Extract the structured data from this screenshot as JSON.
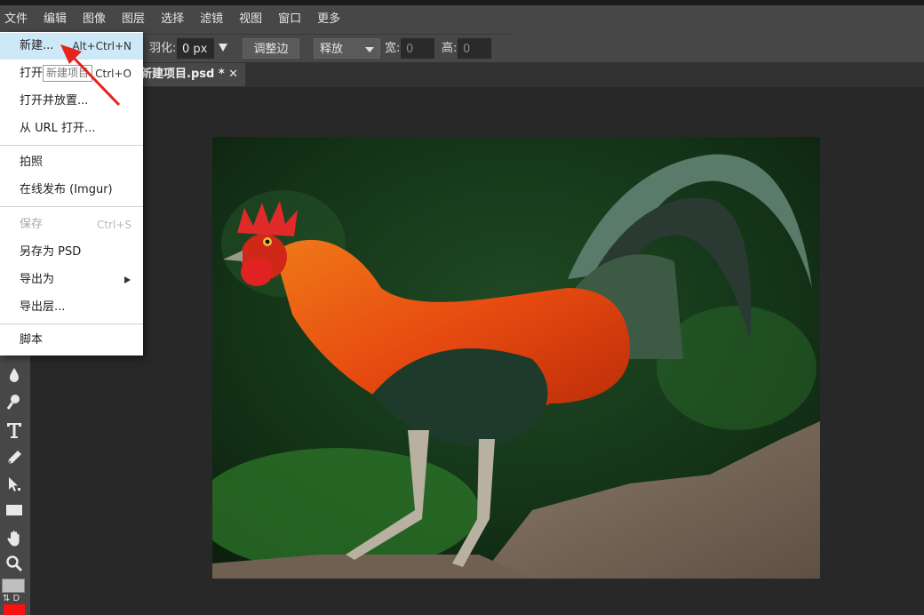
{
  "menubar": {
    "items": [
      "文件",
      "编辑",
      "图像",
      "图层",
      "选择",
      "滤镜",
      "视图",
      "窗口",
      "更多"
    ]
  },
  "options": {
    "feather_label": "羽化:",
    "feather_value": "0 px",
    "refine_edge": "调整边缘",
    "style_value": "释放",
    "width_label": "宽:",
    "width_value": "0",
    "height_label": "高:",
    "height_value": "0"
  },
  "document_tab": {
    "title": "新建项目.psd *",
    "close": "✕"
  },
  "tooltip": "新建项目",
  "file_menu": {
    "items": [
      {
        "label": "新建...",
        "shortcut": "Alt+Ctrl+N"
      },
      {
        "label": "打开...",
        "shortcut": "Ctrl+O"
      },
      {
        "label": "打开并放置...",
        "shortcut": ""
      },
      {
        "label": "从 URL 打开...",
        "shortcut": ""
      },
      {
        "label": "拍照",
        "shortcut": ""
      },
      {
        "label": "在线发布 (Imgur)",
        "shortcut": ""
      },
      {
        "label": "保存",
        "shortcut": "Ctrl+S"
      },
      {
        "label": "另存为 PSD",
        "shortcut": ""
      },
      {
        "label": "导出为",
        "shortcut": ""
      },
      {
        "label": "导出层...",
        "shortcut": ""
      },
      {
        "label": "脚本",
        "shortcut": ""
      }
    ]
  },
  "swatches": {
    "keys": "⇅ D",
    "foreground": "#ff1010",
    "background": "#bfbfbf"
  },
  "colors": {
    "menu_highlight": "#cde8f7",
    "annotation_arrow": "#e8221c"
  },
  "canvas": {
    "subject": "rooster photo"
  }
}
